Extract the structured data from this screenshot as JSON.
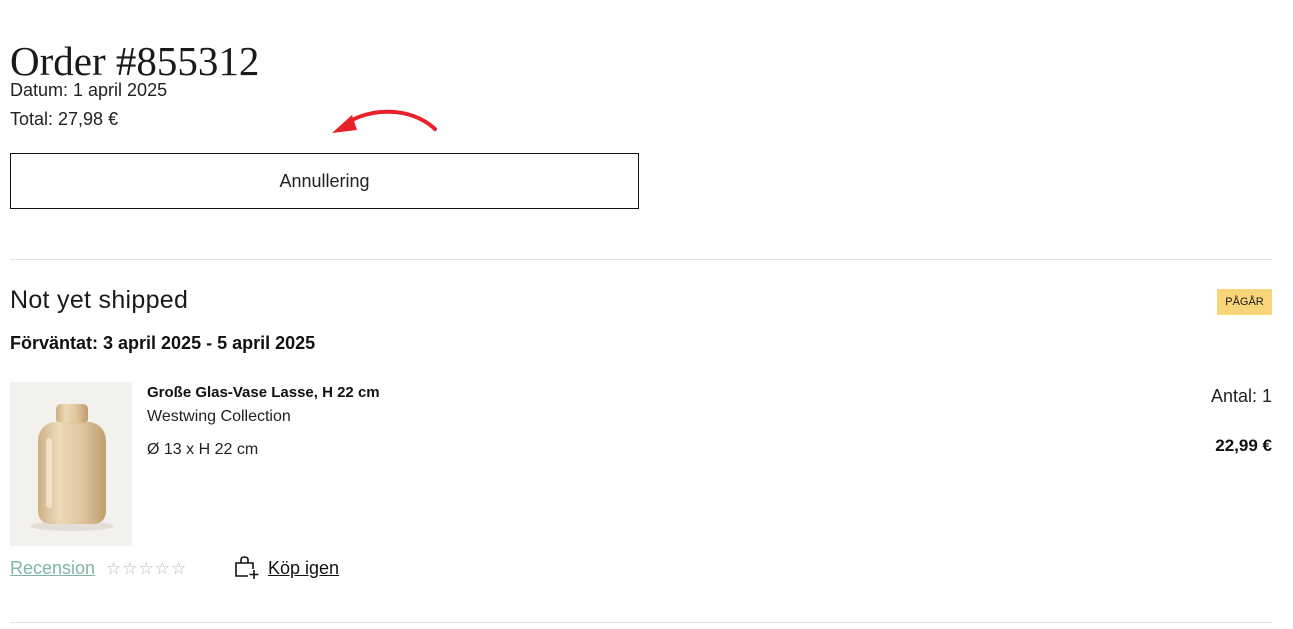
{
  "order": {
    "title": "Order #855312",
    "date_line": "Datum: 1 april 2025",
    "total_line": "Total: 27,98 €",
    "cancel_label": "Annullering"
  },
  "shipment": {
    "status_title": "Not yet shipped",
    "badge": "PÅGÅR",
    "expected": "Förväntat: 3 april 2025 - 5 april 2025",
    "item": {
      "name": "Große Glas-Vase Lasse, H 22 cm",
      "brand": "Westwing Collection",
      "dimensions": "Ø 13 x H 22 cm",
      "quantity": "Antal: 1",
      "price": "22,99 €",
      "image_icon": "glass-vase-image"
    },
    "review_label": "Recension",
    "rating_stars": "☆☆☆☆☆",
    "rating_value": 0,
    "rating_max": 5,
    "buy_again_label": "Köp igen",
    "buy_again_icon": "shopping-bag-plus-icon"
  },
  "colors": {
    "badge_bg": "#f9d57a",
    "review_link": "#7fb5a8",
    "annotation_arrow": "#e8212b",
    "divider": "#e3e3e3"
  }
}
